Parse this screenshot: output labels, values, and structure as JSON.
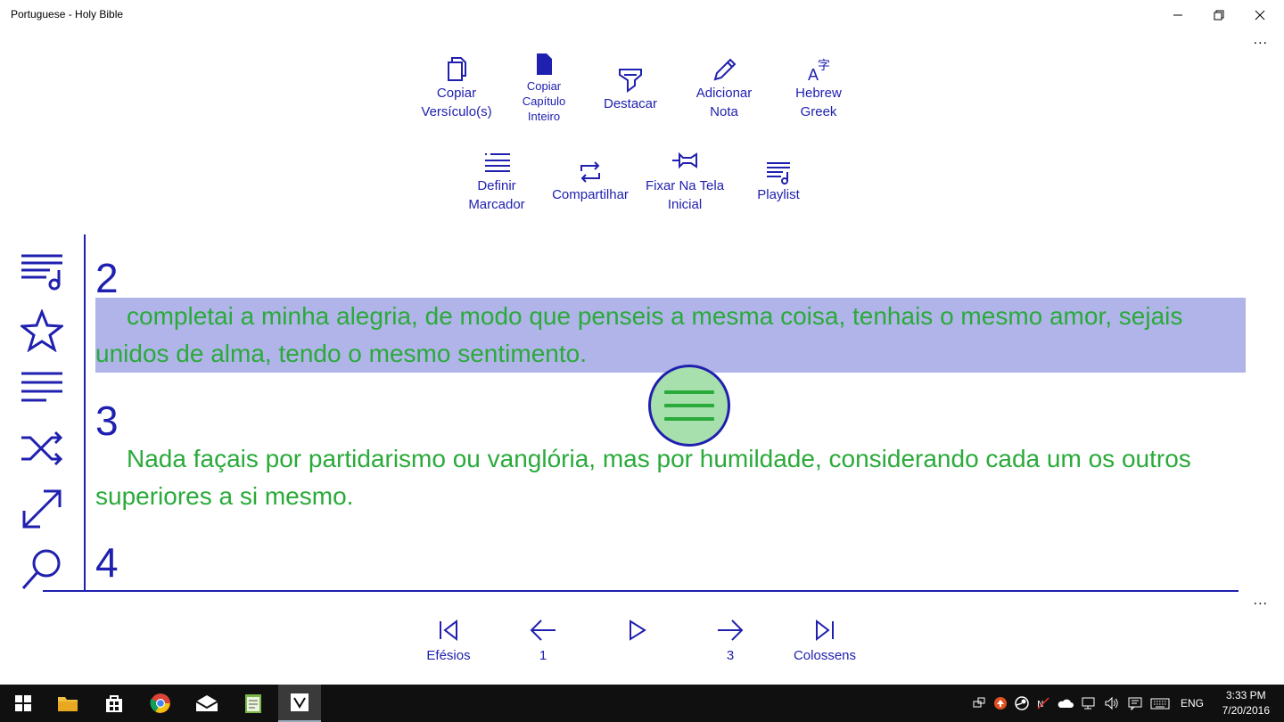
{
  "window": {
    "title": "Portuguese - Holy Bible",
    "more": "..."
  },
  "toolbar": {
    "row1": [
      {
        "id": "copy-verse",
        "icon": "copy-icon",
        "label": "Copiar\nVersículo(s)"
      },
      {
        "id": "copy-chapter",
        "icon": "document-icon",
        "label": "Copiar\nCapítulo\nInteiro"
      },
      {
        "id": "highlight",
        "icon": "highlighter-icon",
        "label": "Destacar"
      },
      {
        "id": "add-note",
        "icon": "pencil-icon",
        "label": "Adicionar\nNota"
      },
      {
        "id": "hebrew-greek",
        "icon": "translate-icon",
        "label": "Hebrew\nGreek"
      }
    ],
    "row2": [
      {
        "id": "bookmark",
        "icon": "list-bookmark-icon",
        "label": "Definir\nMarcador"
      },
      {
        "id": "share",
        "icon": "repeat-share-icon",
        "label": "Compartilhar"
      },
      {
        "id": "pin-start",
        "icon": "pin-icon",
        "label": "Fixar Na Tela\nInicial"
      },
      {
        "id": "playlist",
        "icon": "playlist-icon",
        "label": "Playlist"
      }
    ]
  },
  "sidebar": {
    "items": [
      "playlist-icon",
      "star-icon",
      "list-icon",
      "shuffle-icon",
      "expand-icon",
      "search-icon"
    ]
  },
  "verses": [
    {
      "number": "2",
      "text": "completai a minha alegria, de modo que penseis a mesma coisa, tenhais o mesmo amor, sejais unidos de alma, tendo o mesmo sentimento.",
      "highlighted": true
    },
    {
      "number": "3",
      "text": "Nada façais por partidarismo ou vanglória, mas por humildade, considerando cada um os outros superiores a si mesmo.",
      "highlighted": false
    },
    {
      "number": "4",
      "text": "",
      "highlighted": false
    }
  ],
  "navigation": {
    "first_label": "Efésios",
    "prev_label": "1",
    "play_label": "",
    "next_label": "3",
    "last_label": "Colossens"
  },
  "colors": {
    "accent": "#2020b0",
    "verse_text": "#2aaa3a",
    "highlight": "#b0b4e8",
    "fab_fill": "#a7dfad"
  },
  "taskbar": {
    "language": "ENG",
    "time": "3:33 PM",
    "date": "7/20/2016"
  }
}
